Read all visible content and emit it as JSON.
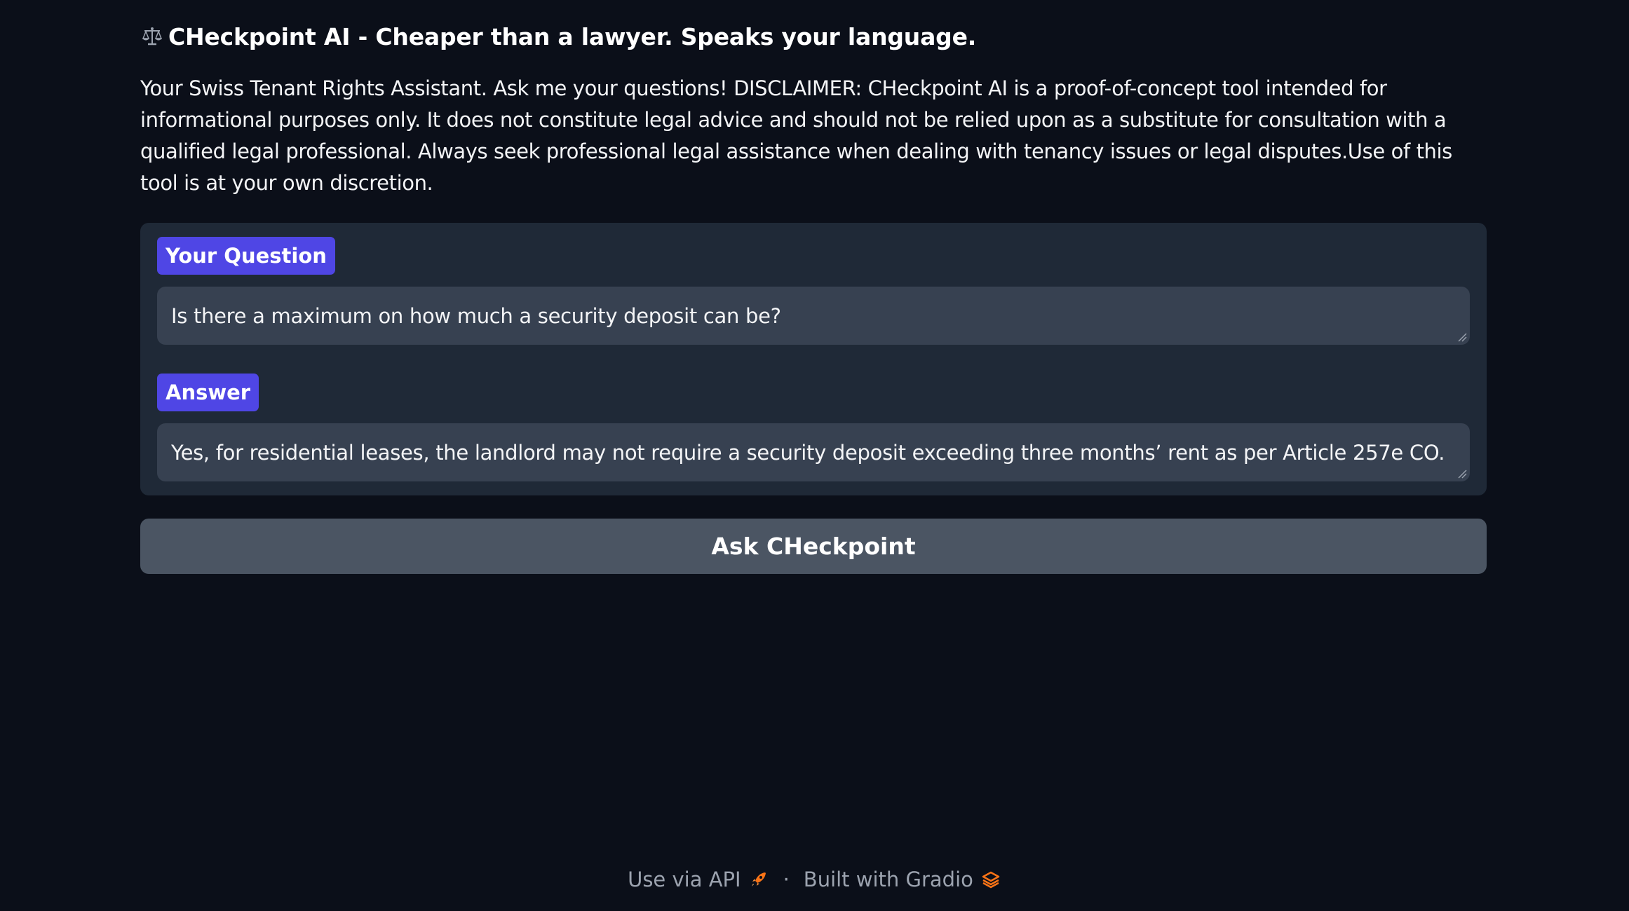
{
  "header": {
    "icon": "balance-scale-icon",
    "title": "CHeckpoint AI - Cheaper than a lawyer. Speaks your language."
  },
  "description": "Your Swiss Tenant Rights Assistant. Ask me your questions! DISCLAIMER: CHeckpoint AI is a proof-of-concept tool intended for informational purposes only. It does not constitute legal advice and should not be relied upon as a substitute for consultation with a qualified legal professional. Always seek professional legal assistance when dealing with tenancy issues or legal disputes.Use of this tool is at your own discretion.",
  "question": {
    "label": "Your Question",
    "value": "Is there a maximum on how much a security deposit can be?"
  },
  "answer": {
    "label": "Answer",
    "value": "Yes, for residential leases, the landlord may not require a security deposit exceeding three months’ rent as per Article 257e CO."
  },
  "submit_button": {
    "label": "Ask CHeckpoint"
  },
  "footer": {
    "api_label": "Use via API",
    "api_icon": "rocket-icon",
    "separator": "·",
    "gradio_label": "Built with Gradio",
    "gradio_icon": "gradio-logo-icon"
  },
  "colors": {
    "background": "#0b0f19",
    "panel": "#1f2937",
    "input": "#374151",
    "label_accent": "#4f46e5",
    "button": "#4b5563",
    "footer_text": "#9ca3af",
    "icon_orange": "#f97316"
  }
}
